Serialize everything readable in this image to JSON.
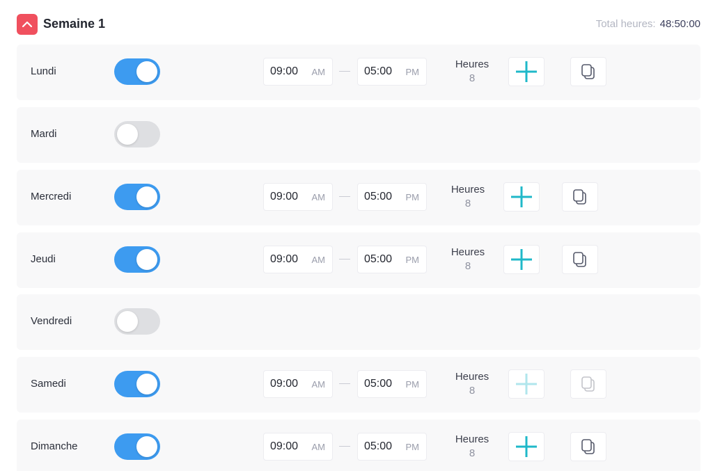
{
  "header": {
    "title": "Semaine 1",
    "total_label": "Total heures:",
    "total_value": "48:50:00",
    "accent_color": "#f0505e"
  },
  "colors": {
    "toggle_on": "#3d9bf0",
    "toggle_off": "#dedfe2",
    "plus_icon": "#1fb8c9"
  },
  "days": [
    {
      "name": "Lundi",
      "enabled": true,
      "start": "09:00",
      "start_period": "AM",
      "end": "05:00",
      "end_period": "PM",
      "hours_label": "Heures",
      "hours": "8"
    },
    {
      "name": "Mardi",
      "enabled": false
    },
    {
      "name": "Mercredi",
      "enabled": true,
      "start": "09:00",
      "start_period": "AM",
      "end": "05:00",
      "end_period": "PM",
      "hours_label": "Heures",
      "hours": "8"
    },
    {
      "name": "Jeudi",
      "enabled": true,
      "start": "09:00",
      "start_period": "AM",
      "end": "05:00",
      "end_period": "PM",
      "hours_label": "Heures",
      "hours": "8"
    },
    {
      "name": "Vendredi",
      "enabled": false
    },
    {
      "name": "Samedi",
      "enabled": true,
      "start": "09:00",
      "start_period": "AM",
      "end": "05:00",
      "end_period": "PM",
      "hours_label": "Heures",
      "hours": "8",
      "actions_faded": true
    },
    {
      "name": "Dimanche",
      "enabled": true,
      "start": "09:00",
      "start_period": "AM",
      "end": "05:00",
      "end_period": "PM",
      "hours_label": "Heures",
      "hours": "8"
    }
  ]
}
